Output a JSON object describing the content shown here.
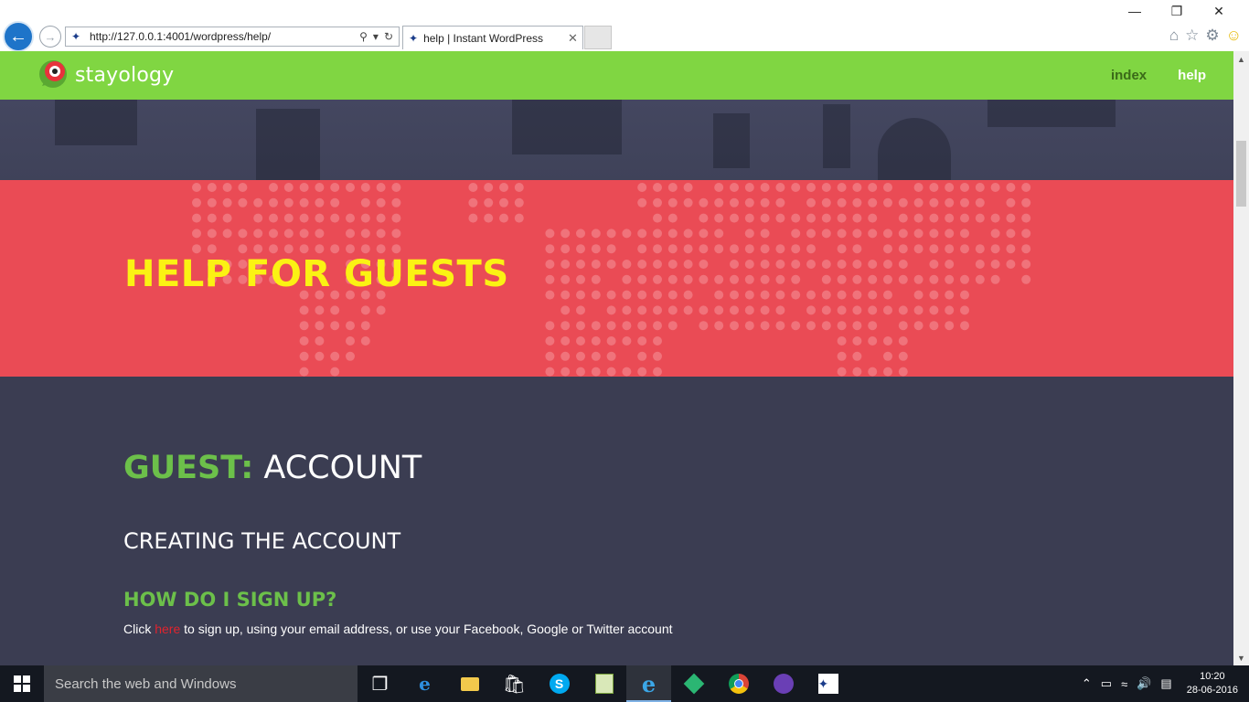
{
  "browser": {
    "url": "http://127.0.0.1:4001/wordpress/help/",
    "tab_title": "help | Instant WordPress"
  },
  "site": {
    "logo_text": "stayology",
    "nav": [
      "index",
      "help"
    ],
    "hero_title": "HELP FOR GUESTS",
    "section_prefix": "GUEST:",
    "section_title": "ACCOUNT",
    "subsection_title": "CREATING THE ACCOUNT",
    "question": "HOW DO I SIGN UP?",
    "answer_prefix": "Click",
    "answer_link": "here",
    "answer_suffix": "to sign up, using your email address, or use your Facebook, Google or Twitter account"
  },
  "colors": {
    "nav_green": "#80d642",
    "hero_red": "#ea4b55",
    "hero_title_yellow": "#fbf213",
    "content_bg": "#3b3d52",
    "accent_green": "#6cc04a",
    "link_red": "#e0242e"
  },
  "taskbar": {
    "search_placeholder": "Search the web and Windows",
    "time": "10:20",
    "date": "28-06-2016"
  }
}
